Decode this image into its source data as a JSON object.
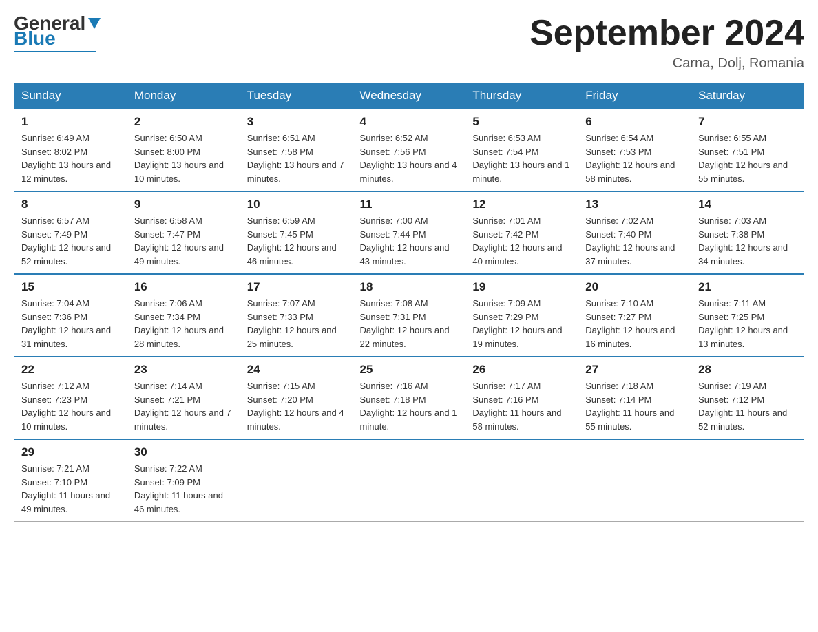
{
  "header": {
    "logo_general": "General",
    "logo_blue": "Blue",
    "month_title": "September 2024",
    "location": "Carna, Dolj, Romania"
  },
  "days_of_week": [
    "Sunday",
    "Monday",
    "Tuesday",
    "Wednesday",
    "Thursday",
    "Friday",
    "Saturday"
  ],
  "weeks": [
    [
      {
        "day": "1",
        "sunrise": "Sunrise: 6:49 AM",
        "sunset": "Sunset: 8:02 PM",
        "daylight": "Daylight: 13 hours and 12 minutes."
      },
      {
        "day": "2",
        "sunrise": "Sunrise: 6:50 AM",
        "sunset": "Sunset: 8:00 PM",
        "daylight": "Daylight: 13 hours and 10 minutes."
      },
      {
        "day": "3",
        "sunrise": "Sunrise: 6:51 AM",
        "sunset": "Sunset: 7:58 PM",
        "daylight": "Daylight: 13 hours and 7 minutes."
      },
      {
        "day": "4",
        "sunrise": "Sunrise: 6:52 AM",
        "sunset": "Sunset: 7:56 PM",
        "daylight": "Daylight: 13 hours and 4 minutes."
      },
      {
        "day": "5",
        "sunrise": "Sunrise: 6:53 AM",
        "sunset": "Sunset: 7:54 PM",
        "daylight": "Daylight: 13 hours and 1 minute."
      },
      {
        "day": "6",
        "sunrise": "Sunrise: 6:54 AM",
        "sunset": "Sunset: 7:53 PM",
        "daylight": "Daylight: 12 hours and 58 minutes."
      },
      {
        "day": "7",
        "sunrise": "Sunrise: 6:55 AM",
        "sunset": "Sunset: 7:51 PM",
        "daylight": "Daylight: 12 hours and 55 minutes."
      }
    ],
    [
      {
        "day": "8",
        "sunrise": "Sunrise: 6:57 AM",
        "sunset": "Sunset: 7:49 PM",
        "daylight": "Daylight: 12 hours and 52 minutes."
      },
      {
        "day": "9",
        "sunrise": "Sunrise: 6:58 AM",
        "sunset": "Sunset: 7:47 PM",
        "daylight": "Daylight: 12 hours and 49 minutes."
      },
      {
        "day": "10",
        "sunrise": "Sunrise: 6:59 AM",
        "sunset": "Sunset: 7:45 PM",
        "daylight": "Daylight: 12 hours and 46 minutes."
      },
      {
        "day": "11",
        "sunrise": "Sunrise: 7:00 AM",
        "sunset": "Sunset: 7:44 PM",
        "daylight": "Daylight: 12 hours and 43 minutes."
      },
      {
        "day": "12",
        "sunrise": "Sunrise: 7:01 AM",
        "sunset": "Sunset: 7:42 PM",
        "daylight": "Daylight: 12 hours and 40 minutes."
      },
      {
        "day": "13",
        "sunrise": "Sunrise: 7:02 AM",
        "sunset": "Sunset: 7:40 PM",
        "daylight": "Daylight: 12 hours and 37 minutes."
      },
      {
        "day": "14",
        "sunrise": "Sunrise: 7:03 AM",
        "sunset": "Sunset: 7:38 PM",
        "daylight": "Daylight: 12 hours and 34 minutes."
      }
    ],
    [
      {
        "day": "15",
        "sunrise": "Sunrise: 7:04 AM",
        "sunset": "Sunset: 7:36 PM",
        "daylight": "Daylight: 12 hours and 31 minutes."
      },
      {
        "day": "16",
        "sunrise": "Sunrise: 7:06 AM",
        "sunset": "Sunset: 7:34 PM",
        "daylight": "Daylight: 12 hours and 28 minutes."
      },
      {
        "day": "17",
        "sunrise": "Sunrise: 7:07 AM",
        "sunset": "Sunset: 7:33 PM",
        "daylight": "Daylight: 12 hours and 25 minutes."
      },
      {
        "day": "18",
        "sunrise": "Sunrise: 7:08 AM",
        "sunset": "Sunset: 7:31 PM",
        "daylight": "Daylight: 12 hours and 22 minutes."
      },
      {
        "day": "19",
        "sunrise": "Sunrise: 7:09 AM",
        "sunset": "Sunset: 7:29 PM",
        "daylight": "Daylight: 12 hours and 19 minutes."
      },
      {
        "day": "20",
        "sunrise": "Sunrise: 7:10 AM",
        "sunset": "Sunset: 7:27 PM",
        "daylight": "Daylight: 12 hours and 16 minutes."
      },
      {
        "day": "21",
        "sunrise": "Sunrise: 7:11 AM",
        "sunset": "Sunset: 7:25 PM",
        "daylight": "Daylight: 12 hours and 13 minutes."
      }
    ],
    [
      {
        "day": "22",
        "sunrise": "Sunrise: 7:12 AM",
        "sunset": "Sunset: 7:23 PM",
        "daylight": "Daylight: 12 hours and 10 minutes."
      },
      {
        "day": "23",
        "sunrise": "Sunrise: 7:14 AM",
        "sunset": "Sunset: 7:21 PM",
        "daylight": "Daylight: 12 hours and 7 minutes."
      },
      {
        "day": "24",
        "sunrise": "Sunrise: 7:15 AM",
        "sunset": "Sunset: 7:20 PM",
        "daylight": "Daylight: 12 hours and 4 minutes."
      },
      {
        "day": "25",
        "sunrise": "Sunrise: 7:16 AM",
        "sunset": "Sunset: 7:18 PM",
        "daylight": "Daylight: 12 hours and 1 minute."
      },
      {
        "day": "26",
        "sunrise": "Sunrise: 7:17 AM",
        "sunset": "Sunset: 7:16 PM",
        "daylight": "Daylight: 11 hours and 58 minutes."
      },
      {
        "day": "27",
        "sunrise": "Sunrise: 7:18 AM",
        "sunset": "Sunset: 7:14 PM",
        "daylight": "Daylight: 11 hours and 55 minutes."
      },
      {
        "day": "28",
        "sunrise": "Sunrise: 7:19 AM",
        "sunset": "Sunset: 7:12 PM",
        "daylight": "Daylight: 11 hours and 52 minutes."
      }
    ],
    [
      {
        "day": "29",
        "sunrise": "Sunrise: 7:21 AM",
        "sunset": "Sunset: 7:10 PM",
        "daylight": "Daylight: 11 hours and 49 minutes."
      },
      {
        "day": "30",
        "sunrise": "Sunrise: 7:22 AM",
        "sunset": "Sunset: 7:09 PM",
        "daylight": "Daylight: 11 hours and 46 minutes."
      },
      null,
      null,
      null,
      null,
      null
    ]
  ]
}
